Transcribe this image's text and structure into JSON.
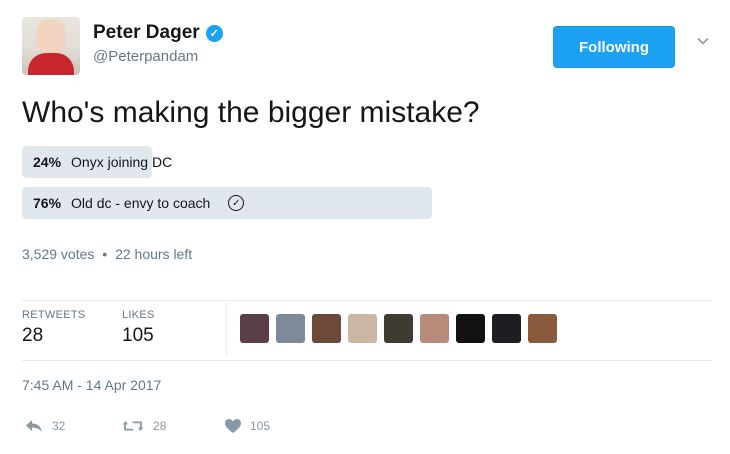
{
  "user": {
    "name": "Peter Dager",
    "handle": "@Peterpandam",
    "verified_icon": "verified-badge-icon"
  },
  "follow_button": {
    "label": "Following"
  },
  "tweet": {
    "text": "Who's making the bigger mistake?"
  },
  "poll": {
    "options": [
      {
        "percent": 24,
        "percent_label": "24%",
        "label": "Onyx joining DC",
        "selected": false
      },
      {
        "percent": 76,
        "percent_label": "76%",
        "label": "Old dc - envy to coach",
        "selected": true
      }
    ],
    "votes": "3,529 votes",
    "separator": "•",
    "time_left": "22 hours left"
  },
  "stats": {
    "retweets_label": "RETWEETS",
    "retweets_value": "28",
    "likes_label": "LIKES",
    "likes_value": "105"
  },
  "timestamp": "7:45 AM - 14 Apr 2017",
  "actions": {
    "reply_count": "32",
    "retweet_count": "28",
    "like_count": "105"
  },
  "colors": {
    "accent": "#1da1f2",
    "poll_bar": "#e1e8ed",
    "muted_text": "#657786"
  },
  "likers": [
    {
      "icon": "liker-avatar-1",
      "color": "#5a3e4a"
    },
    {
      "icon": "liker-avatar-2",
      "color": "#7c8a99"
    },
    {
      "icon": "liker-avatar-3",
      "color": "#6b4a3a"
    },
    {
      "icon": "liker-avatar-4",
      "color": "#c9b7a4"
    },
    {
      "icon": "liker-avatar-5",
      "color": "#3e3b30"
    },
    {
      "icon": "liker-avatar-6",
      "color": "#b78a7a"
    },
    {
      "icon": "liker-avatar-7",
      "color": "#111111"
    },
    {
      "icon": "liker-avatar-8",
      "color": "#1e1e22"
    },
    {
      "icon": "liker-avatar-9",
      "color": "#8a5a3c"
    }
  ]
}
